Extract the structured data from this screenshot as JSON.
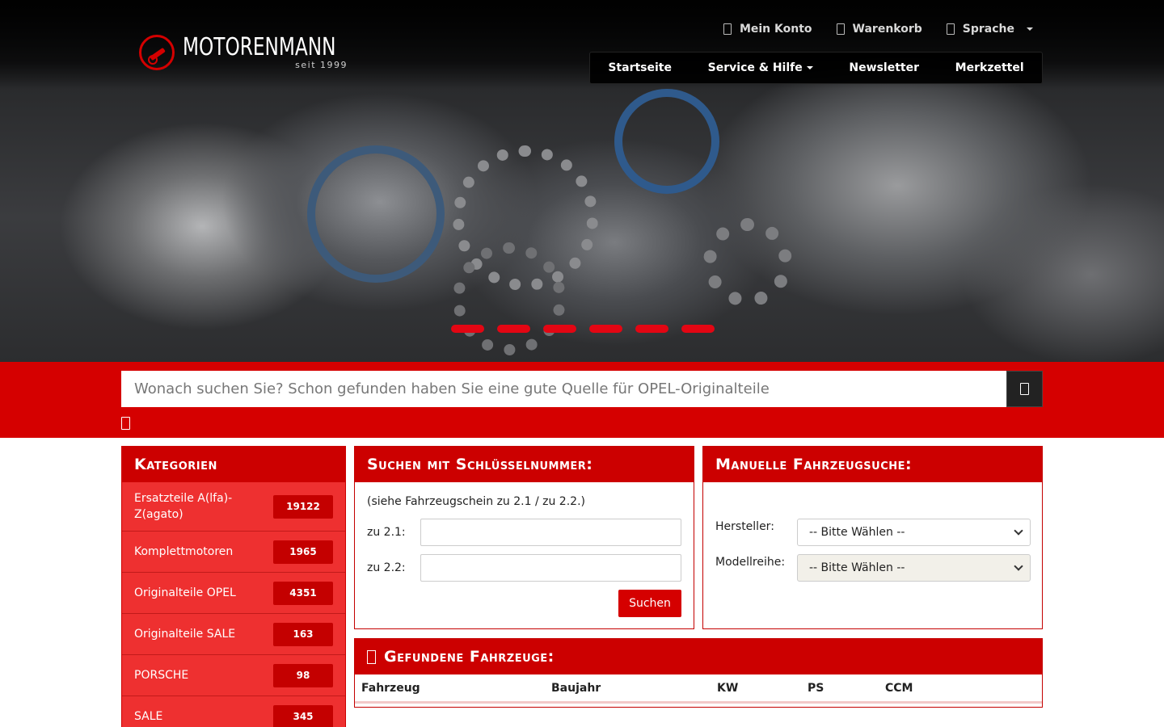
{
  "brand": {
    "name": "MOTORENMANN",
    "since": "seit 1999",
    "accent": "#d50000"
  },
  "topnav": [
    {
      "label": "Mein Konto",
      "icon": "user-icon"
    },
    {
      "label": "Warenkorb",
      "icon": "cart-icon"
    },
    {
      "label": "Sprache",
      "icon": "globe-icon",
      "dropdown": true
    }
  ],
  "mainnav": [
    {
      "label": "Startseite"
    },
    {
      "label": "Service & Hilfe",
      "dropdown": true
    },
    {
      "label": "Newsletter"
    },
    {
      "label": "Merkzettel"
    }
  ],
  "slider": {
    "dots": 6
  },
  "search": {
    "placeholder": "Wonach suchen Sie? Schon gefunden haben Sie eine gute Quelle für OPEL-Originalteile"
  },
  "categories": {
    "title": "Kategorien",
    "items": [
      {
        "label": "Ersatzteile A(lfa)-Z(agato)",
        "count": "19122"
      },
      {
        "label": "Komplettmotoren",
        "count": "1965"
      },
      {
        "label": "Originalteile OPEL",
        "count": "4351"
      },
      {
        "label": "Originalteile SALE",
        "count": "163"
      },
      {
        "label": "PORSCHE",
        "count": "98"
      },
      {
        "label": "SALE",
        "count": "345"
      }
    ]
  },
  "keysearch": {
    "title": "Suchen mit Schlüsselnummer:",
    "hint": "(siehe Fahrzeugschein zu 2.1 / zu 2.2.)",
    "field1_label": "zu 2.1:",
    "field2_label": "zu 2.2:",
    "button": "Suchen"
  },
  "manual": {
    "title": "Manuelle Fahrzeugsuche:",
    "maker_label": "Hersteller:",
    "maker_value": "-- Bitte Wählen --",
    "model_label": "Modellreihe:",
    "model_value": "-- Bitte Wählen --"
  },
  "found": {
    "title": "Gefundene Fahrzeuge:",
    "columns": [
      "Fahrzeug",
      "Baujahr",
      "KW",
      "PS",
      "CCM"
    ]
  }
}
